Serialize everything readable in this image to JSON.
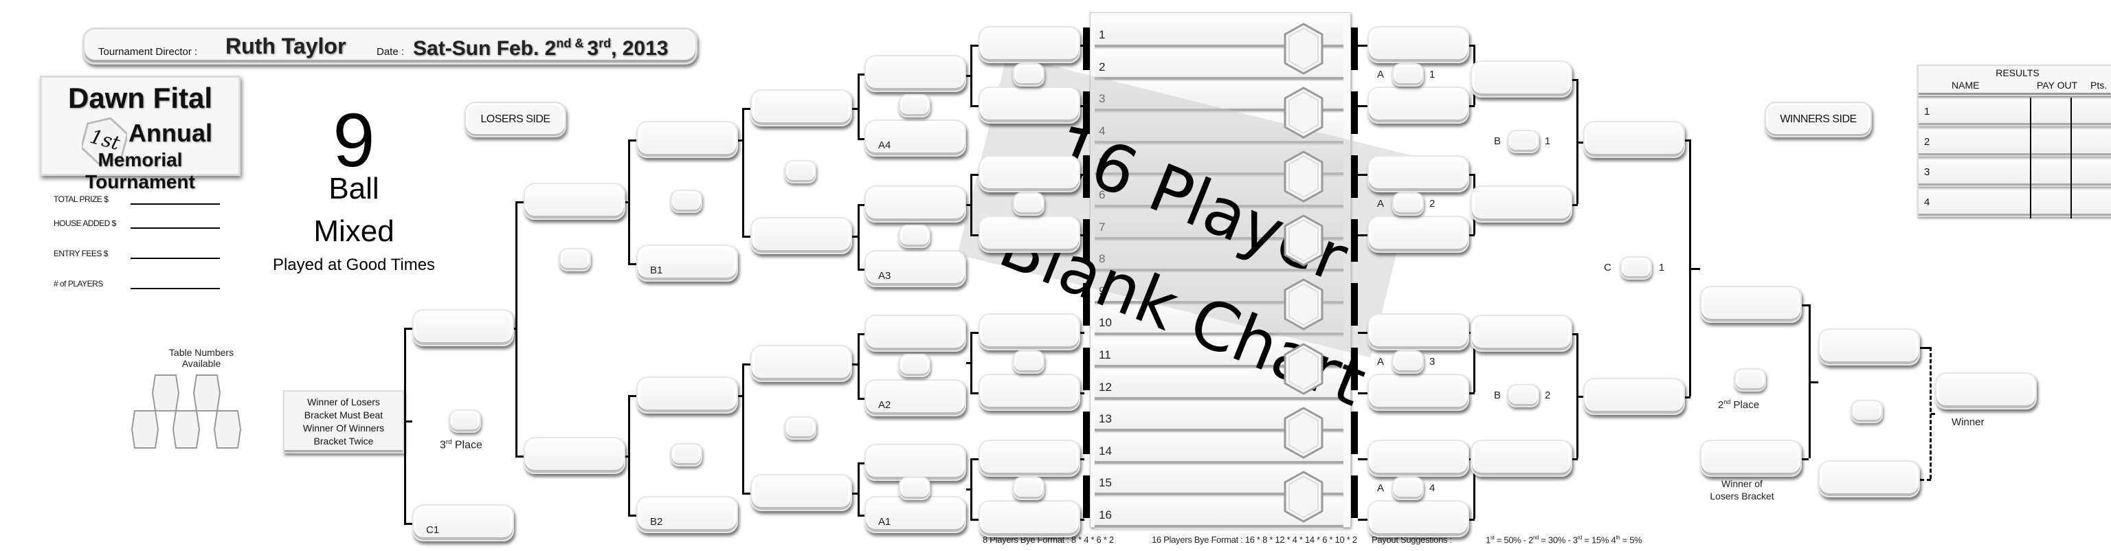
{
  "header": {
    "director_label": "Tournament Director :",
    "director_name": "Ruth Taylor",
    "date_label": "Date :",
    "date_value_part1": "Sat-Sun Feb. 2",
    "date_sup1": "nd",
    "date_amp": " & ",
    "date_value_part2": "3",
    "date_sup2": "rd",
    "date_value_part3": ", 2013"
  },
  "logo": {
    "line1": "Dawn Fital",
    "badge": "1st",
    "line2": "Annual",
    "line3": "Memorial Tournament"
  },
  "info_fields": [
    {
      "label": "TOTAL PRIZE $",
      "value": ""
    },
    {
      "label": "HOUSE ADDED $",
      "value": ""
    },
    {
      "label": "ENTRY FEES $",
      "value": ""
    },
    {
      "label": "# of PLAYERS",
      "value": ""
    }
  ],
  "game": {
    "number": "9",
    "type": "Ball",
    "format": "Mixed",
    "venue": "Played at Good Times"
  },
  "table_numbers": {
    "label_line1": "Table Numbers",
    "label_line2": "Available",
    "count": 5
  },
  "rule_note": {
    "line1": "Winner of Losers",
    "line2": "Bracket  Must Beat",
    "line3": "Winner Of Winners",
    "line4": "Bracket Twice"
  },
  "sides": {
    "losers": "LOSERS SIDE",
    "winners": "WINNERS SIDE"
  },
  "players": [
    "1",
    "2",
    "3",
    "4",
    "5",
    "6",
    "7",
    "8",
    "9",
    "10",
    "11",
    "12",
    "13",
    "14",
    "15",
    "16"
  ],
  "losers_labels": {
    "a4": "A4",
    "a3": "A3",
    "a2": "A2",
    "a1": "A1",
    "b1": "B1",
    "b2": "B2",
    "c1": "C1"
  },
  "third_place": {
    "num": "3",
    "sup": "rd",
    "text": " Place"
  },
  "winners_labels": {
    "A": "A",
    "B": "B",
    "C": "C",
    "a1": "1",
    "a2": "2",
    "a3": "3",
    "a4": "4",
    "b1": "1",
    "b2": "2",
    "c1": "1"
  },
  "second_place": {
    "num": "2",
    "sup": "nd",
    "text": " Place"
  },
  "winner_of_losers": {
    "line1": "Winner of",
    "line2": "Losers Bracket"
  },
  "winner_label": "Winner",
  "watermark": {
    "line1": "16 Player",
    "line2": "Blank Chart"
  },
  "results": {
    "title": "RESULTS",
    "columns": [
      "NAME",
      "PAY OUT",
      "Pts."
    ],
    "rows": [
      {
        "place": "1",
        "name": "",
        "payout": "",
        "pts": ""
      },
      {
        "place": "2",
        "name": "",
        "payout": "",
        "pts": ""
      },
      {
        "place": "3",
        "name": "",
        "payout": "",
        "pts": ""
      },
      {
        "place": "4",
        "name": "",
        "payout": "",
        "pts": ""
      }
    ]
  },
  "footer": {
    "bye8": "8 Players Bye Format : 8 * 4 * 6 * 2",
    "bye16": "16 Players Bye Format : 16 * 8 * 12 * 4 * 14 * 6 * 10 * 2",
    "payout_label": "Payout Suggestions :",
    "payout": [
      {
        "n": "1",
        "sup": "st",
        "pct": " = 50% - "
      },
      {
        "n": "2",
        "sup": "nd",
        "pct": " = 30% - "
      },
      {
        "n": "3",
        "sup": "rd",
        "pct": " = 15% "
      },
      {
        "n": "4",
        "sup": "th",
        "pct": " = 5%"
      }
    ]
  }
}
